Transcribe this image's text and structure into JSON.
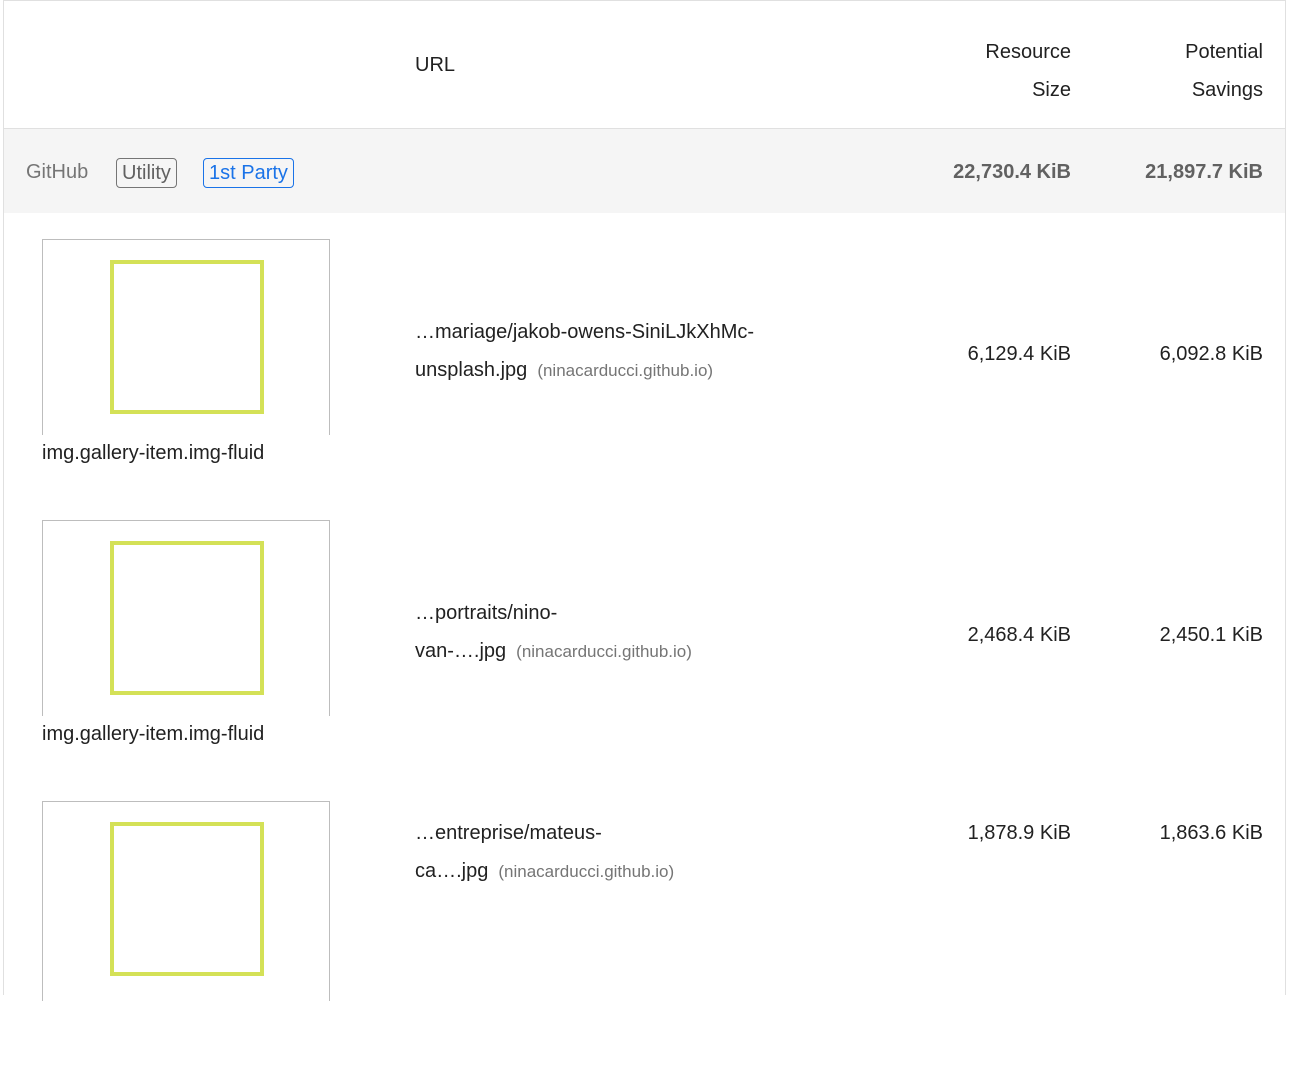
{
  "header": {
    "url_label": "URL",
    "resource_size_line1": "Resource",
    "resource_size_line2": "Size",
    "potential_savings_line1": "Potential",
    "potential_savings_line2": "Savings"
  },
  "group": {
    "name": "GitHub",
    "badge_utility": "Utility",
    "badge_party": "1st Party",
    "resource_size": "22,730.4 KiB",
    "potential_savings": "21,897.7 KiB"
  },
  "items": [
    {
      "node_label": "img.gallery-item.img-fluid",
      "url_line1": "…mariage/jakob-owens-SiniLJkXhMc-",
      "url_line2": "unsplash.jpg",
      "host": "(ninacarducci.github.io)",
      "resource_size": "6,129.4 KiB",
      "potential_savings": "6,092.8 KiB"
    },
    {
      "node_label": "img.gallery-item.img-fluid",
      "url_line1": "…portraits/nino-",
      "url_line2": "van-….jpg",
      "host": "(ninacarducci.github.io)",
      "resource_size": "2,468.4 KiB",
      "potential_savings": "2,450.1 KiB"
    },
    {
      "node_label": "",
      "url_line1": "…entreprise/mateus-",
      "url_line2": "ca….jpg",
      "host": "(ninacarducci.github.io)",
      "resource_size": "1,878.9 KiB",
      "potential_savings": "1,863.6 KiB"
    }
  ],
  "colors": {
    "thumbnail_square": "#d4e157",
    "first_party_badge": "#1a73e8"
  }
}
